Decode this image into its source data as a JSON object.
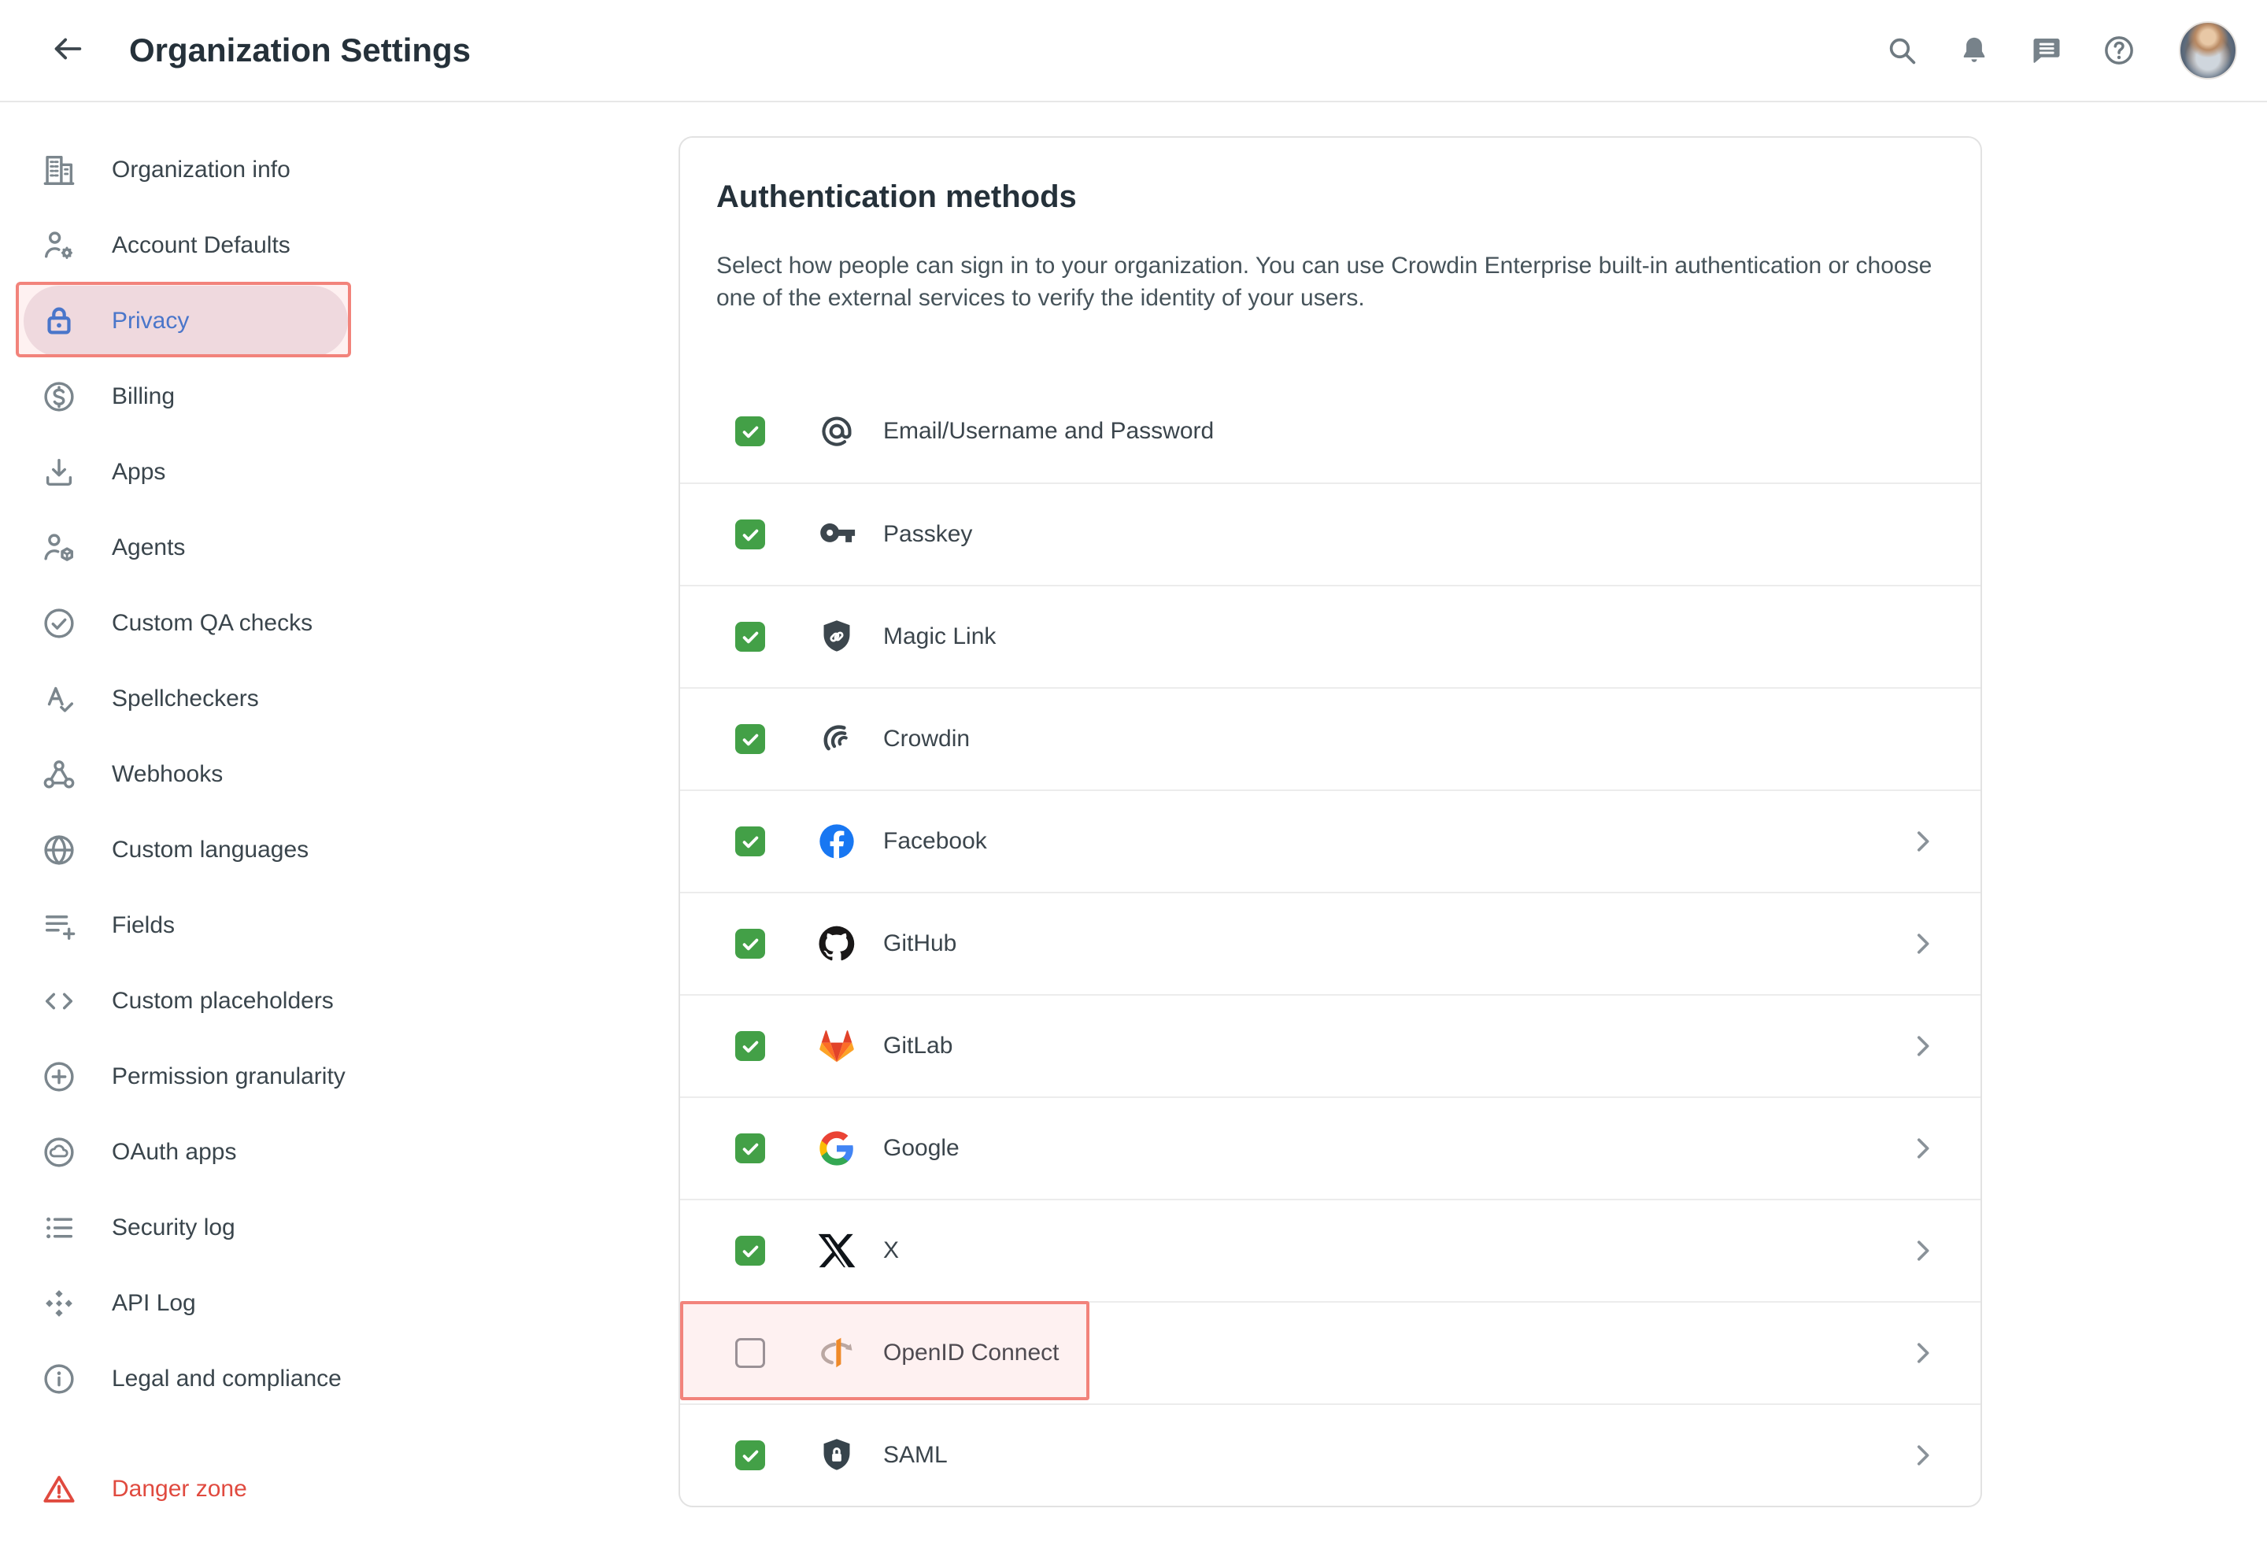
{
  "header": {
    "title": "Organization Settings",
    "icons": [
      "back-icon",
      "search-icon",
      "notifications-bell-icon",
      "messages-icon",
      "help-icon",
      "user-avatar"
    ]
  },
  "sidebar": {
    "items": [
      {
        "label": "Organization info",
        "icon": "building-icon"
      },
      {
        "label": "Account Defaults",
        "icon": "person-gear-icon"
      },
      {
        "label": "Privacy",
        "icon": "lock-icon",
        "active": true,
        "highlighted": true
      },
      {
        "label": "Billing",
        "icon": "dollar-circle-icon"
      },
      {
        "label": "Apps",
        "icon": "download-icon"
      },
      {
        "label": "Agents",
        "icon": "person-cube-icon"
      },
      {
        "label": "Custom QA checks",
        "icon": "check-circle-icon"
      },
      {
        "label": "Spellcheckers",
        "icon": "spellcheck-icon"
      },
      {
        "label": "Webhooks",
        "icon": "webhook-icon"
      },
      {
        "label": "Custom languages",
        "icon": "globe-icon"
      },
      {
        "label": "Fields",
        "icon": "list-add-icon"
      },
      {
        "label": "Custom placeholders",
        "icon": "code-brackets-icon"
      },
      {
        "label": "Permission granularity",
        "icon": "plus-circle-icon"
      },
      {
        "label": "OAuth apps",
        "icon": "cloud-circle-icon"
      },
      {
        "label": "Security log",
        "icon": "bulleted-list-icon"
      },
      {
        "label": "API Log",
        "icon": "diamonds-icon"
      },
      {
        "label": "Legal and compliance",
        "icon": "info-circle-icon"
      },
      {
        "label": "Danger zone",
        "icon": "warning-triangle-icon",
        "danger": true
      }
    ]
  },
  "main": {
    "heading": "Authentication methods",
    "description": "Select how people can sign in to your organization. You can use Crowdin Enterprise built-in authentication or choose one of the external services to verify the identity of your users.",
    "methods": [
      {
        "label": "Email/Username and Password",
        "icon": "at-icon",
        "checked": true,
        "chevron": false
      },
      {
        "label": "Passkey",
        "icon": "key-icon",
        "checked": true,
        "chevron": false
      },
      {
        "label": "Magic Link",
        "icon": "shield-link-icon",
        "checked": true,
        "chevron": false
      },
      {
        "label": "Crowdin",
        "icon": "crowdin-icon",
        "checked": true,
        "chevron": false
      },
      {
        "label": "Facebook",
        "icon": "facebook-icon",
        "checked": true,
        "chevron": true
      },
      {
        "label": "GitHub",
        "icon": "github-icon",
        "checked": true,
        "chevron": true
      },
      {
        "label": "GitLab",
        "icon": "gitlab-icon",
        "checked": true,
        "chevron": true
      },
      {
        "label": "Google",
        "icon": "google-icon",
        "checked": true,
        "chevron": true
      },
      {
        "label": "X",
        "icon": "x-icon",
        "checked": true,
        "chevron": true
      },
      {
        "label": "OpenID Connect",
        "icon": "openid-icon",
        "checked": false,
        "chevron": true,
        "highlighted": true
      },
      {
        "label": "SAML",
        "icon": "saml-icon",
        "checked": true,
        "chevron": true
      }
    ]
  },
  "colors": {
    "accent_blue": "#3575d4",
    "checkbox_green": "#43a047",
    "danger_red": "#e04a3f",
    "annotation_border": "#f2837b",
    "facebook_blue": "#1877F2",
    "text_dark": "#25313a"
  }
}
